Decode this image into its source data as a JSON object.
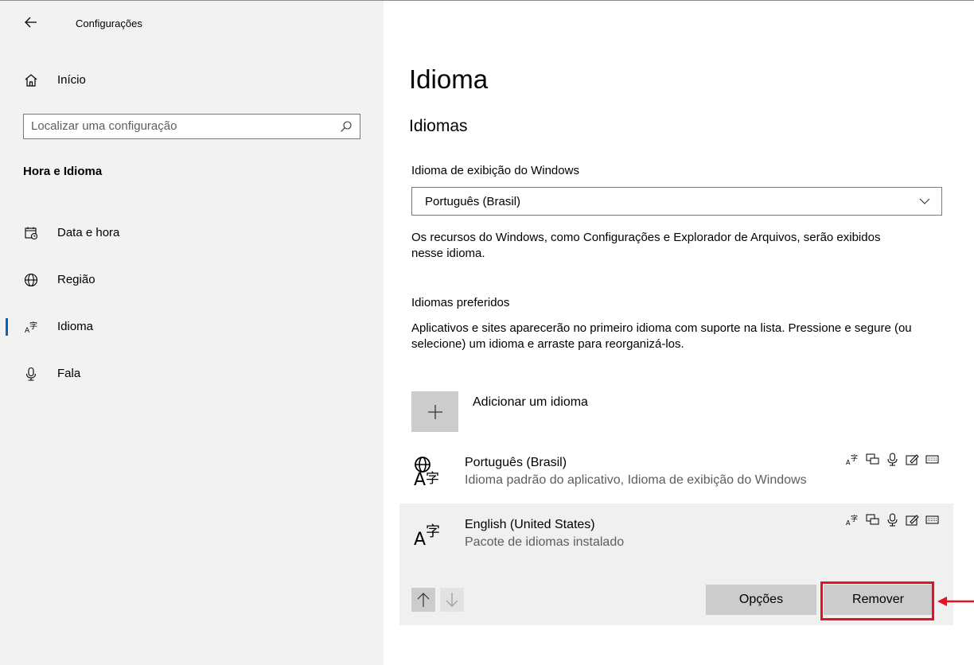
{
  "window": {
    "title": "Configurações"
  },
  "sidebar": {
    "home_label": "Início",
    "search_placeholder": "Localizar uma configuração",
    "section_title": "Hora e Idioma",
    "items": [
      {
        "label": "Data e hora",
        "icon": "calendar-clock-icon"
      },
      {
        "label": "Região",
        "icon": "globe-icon"
      },
      {
        "label": "Idioma",
        "icon": "language-icon",
        "active": true
      },
      {
        "label": "Fala",
        "icon": "microphone-icon"
      }
    ]
  },
  "main": {
    "page_title": "Idioma",
    "section_title": "Idiomas",
    "display_language_label": "Idioma de exibição do Windows",
    "display_language_value": "Português (Brasil)",
    "display_language_desc": "Os recursos do Windows, como Configurações e Explorador de Arquivos, serão exibidos nesse idioma.",
    "preferred_label": "Idiomas preferidos",
    "preferred_desc": "Aplicativos e sites aparecerão no primeiro idioma com suporte na lista. Pressione e segure (ou selecione) um idioma e arraste para reorganizá-los.",
    "add_language_label": "Adicionar um idioma",
    "languages": [
      {
        "name": "Português (Brasil)",
        "detail": "Idioma padrão do aplicativo, Idioma de exibição do Windows"
      },
      {
        "name": "English (United States)",
        "detail": "Pacote de idiomas instalado"
      }
    ],
    "options_button": "Opções",
    "remove_button": "Remover"
  },
  "colors": {
    "accent": "#0067c0",
    "highlight": "#e81123",
    "sidebar_bg": "#f2f2f2",
    "button_bg": "#cccccc"
  }
}
